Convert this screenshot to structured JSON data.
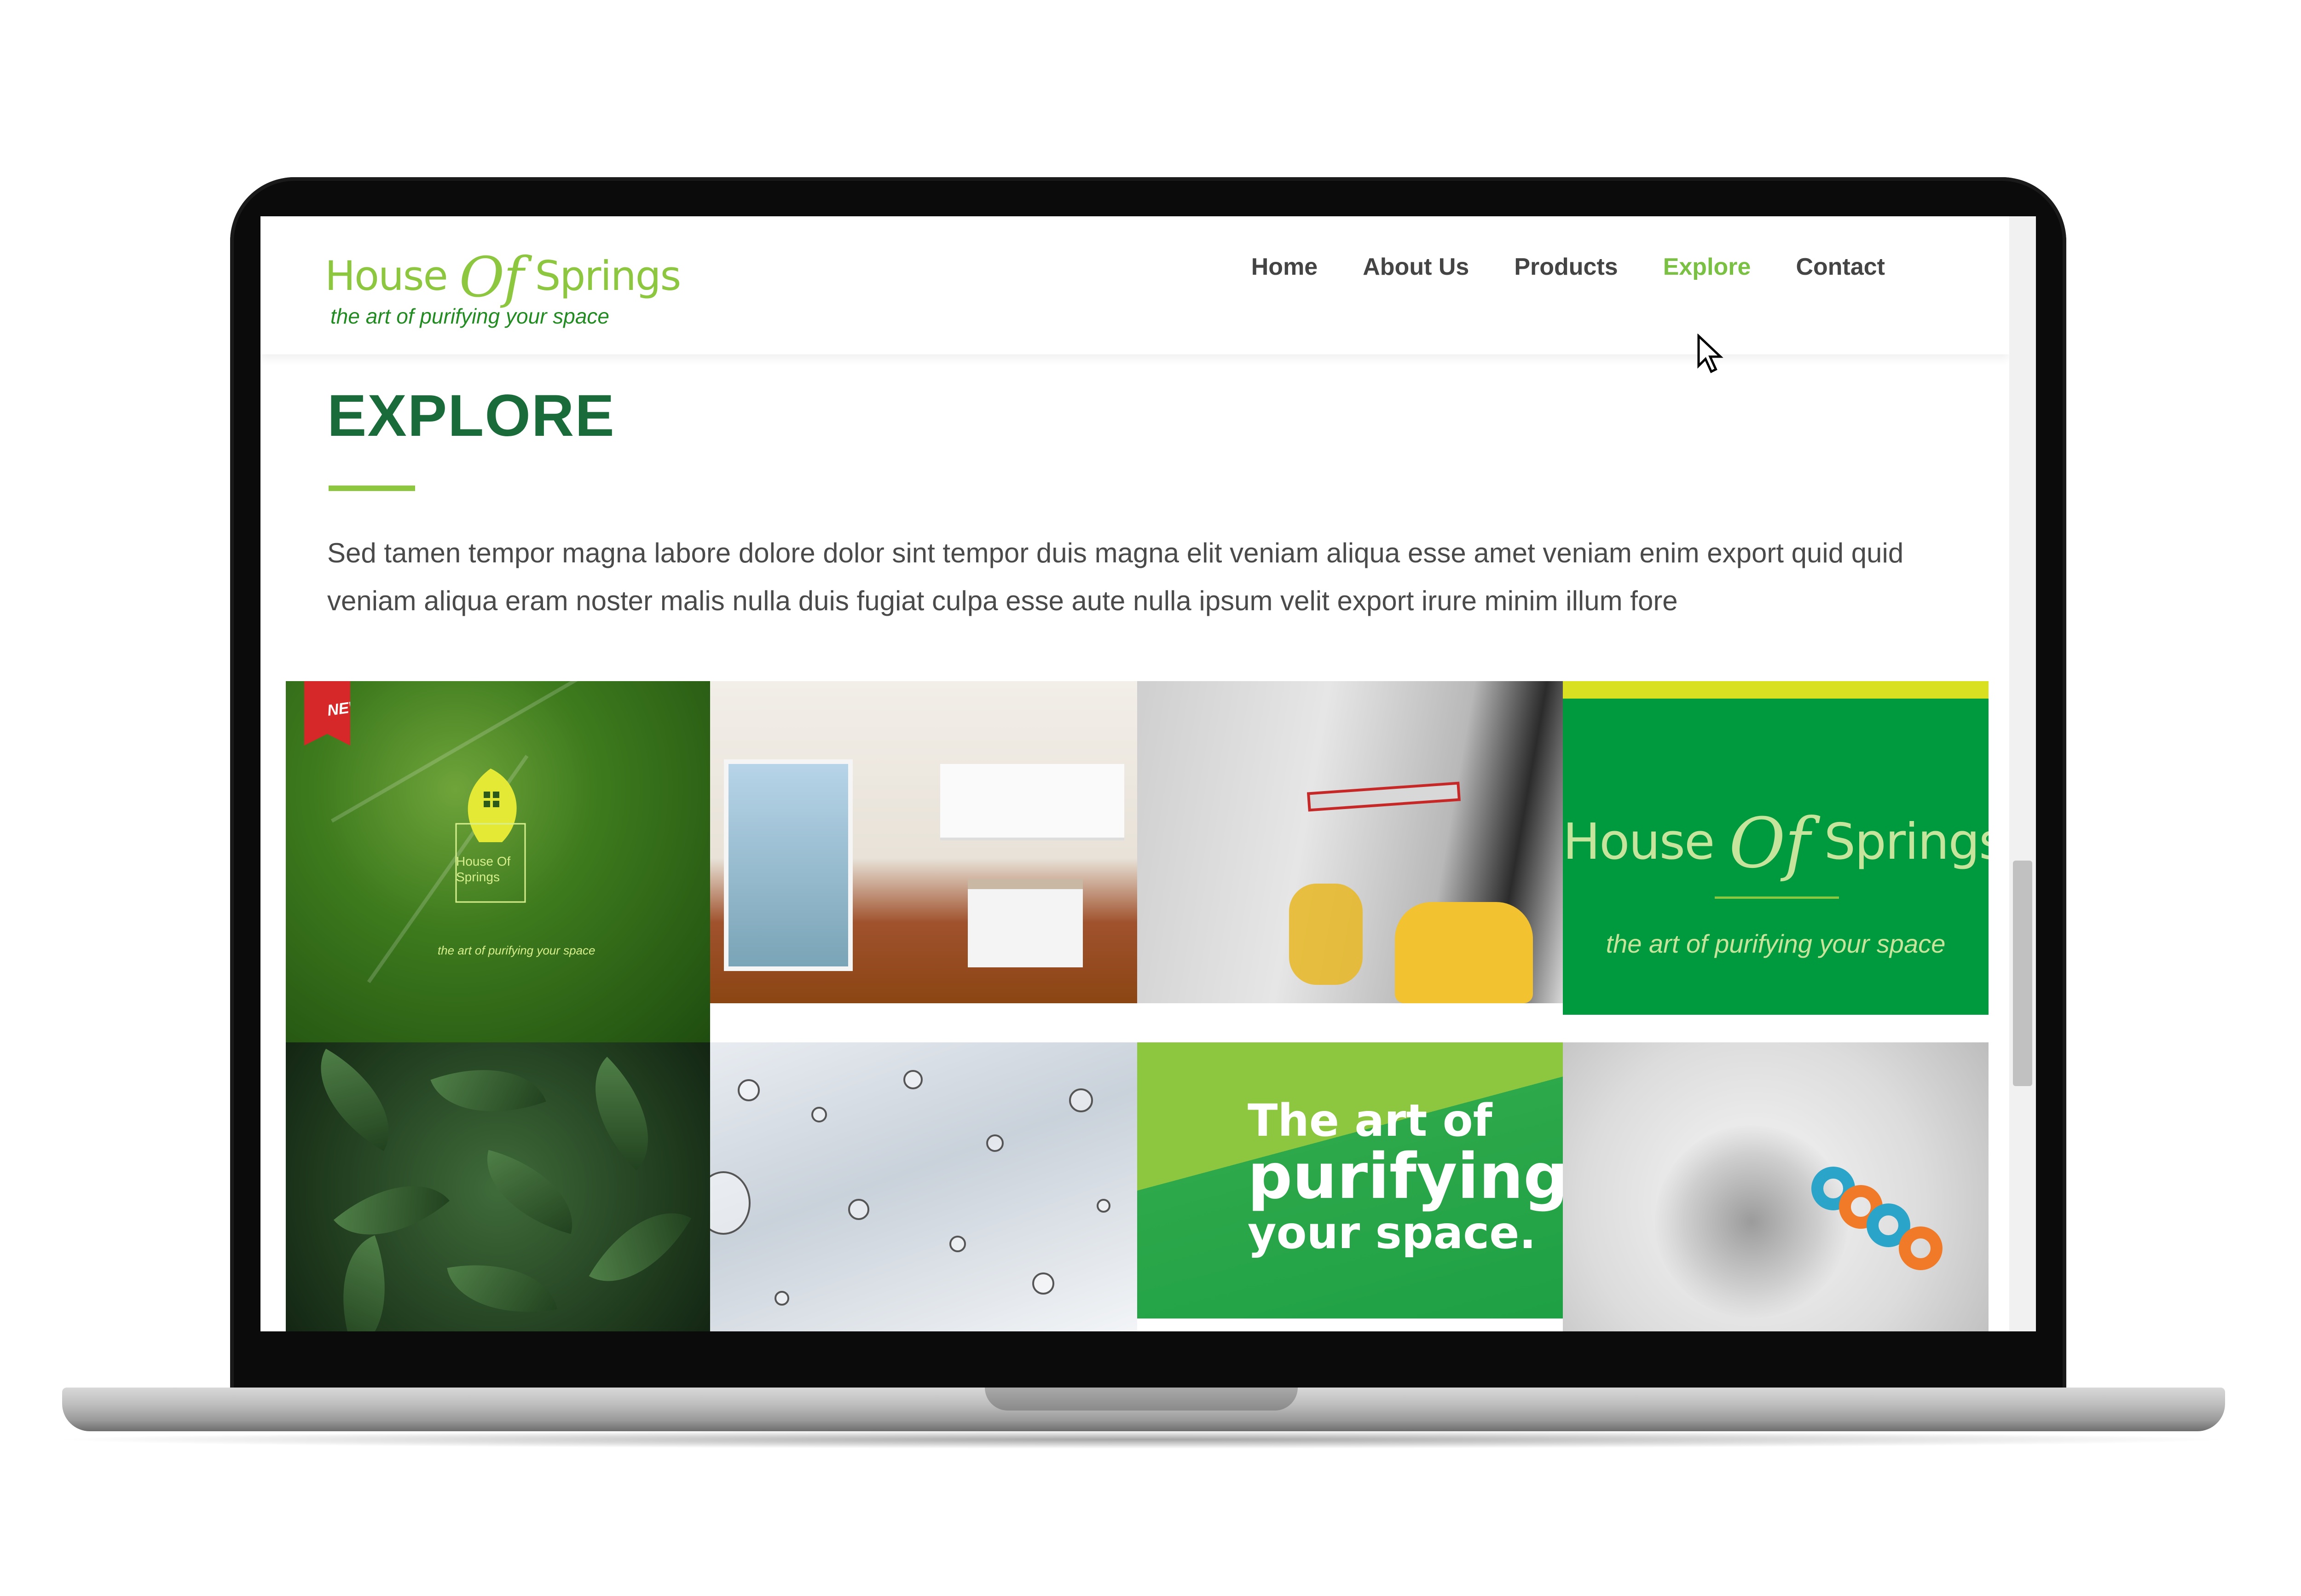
{
  "site": {
    "logo": {
      "word_house": "House",
      "word_of": "Of",
      "word_springs": "Springs",
      "tagline": "the art of purifying your space"
    },
    "nav": [
      {
        "label": "Home"
      },
      {
        "label": "About Us"
      },
      {
        "label": "Products"
      },
      {
        "label": "Explore",
        "active": true
      },
      {
        "label": "Contact"
      }
    ]
  },
  "page": {
    "title": "EXPLORE",
    "intro": "Sed tamen tempor magna labore dolore dolor sint tempor duis magna elit veniam aliqua esse amet veniam enim export quid quid veniam aliqua eram noster malis nulla duis fugiat culpa esse aute nulla ipsum velit export irure minim illum fore"
  },
  "gallery": {
    "tile1": {
      "badge": "NEW",
      "logo_line1": "House Of",
      "logo_line2": "Springs",
      "caption": "the art of purifying your space"
    },
    "tile4": {
      "word_house": "House",
      "word_of": "Of",
      "word_springs": "Springs",
      "tagline": "the art of purifying your space"
    },
    "tile7": {
      "line1": "The art of",
      "line2": "purifying",
      "line3": "your space."
    }
  },
  "colors": {
    "brand_green": "#8dc63f",
    "dark_green": "#1a6b3a",
    "nav_active": "#7ac143",
    "tile_green": "#009a3e"
  },
  "icons": [
    "cursor-icon",
    "new-badge",
    "leaf-logo-icon"
  ]
}
